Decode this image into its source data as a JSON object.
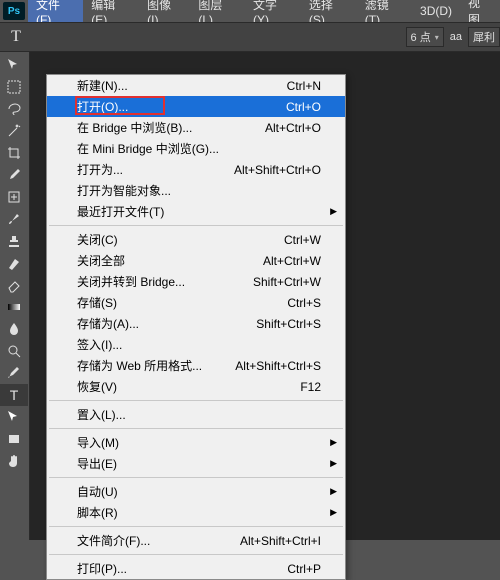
{
  "logo": "Ps",
  "menubar": [
    {
      "label": "文件(F)",
      "active": true
    },
    {
      "label": "编辑(E)"
    },
    {
      "label": "图像(I)"
    },
    {
      "label": "图层(L)"
    },
    {
      "label": "文字(Y)"
    },
    {
      "label": "选择(S)"
    },
    {
      "label": "滤镜(T)"
    },
    {
      "label": "3D(D)"
    },
    {
      "label": "视图"
    }
  ],
  "optbar": {
    "tool_glyph": "T",
    "size_value": "6 点",
    "aa_label": "aa",
    "mode_label": "犀利"
  },
  "dropdown": [
    {
      "type": "item",
      "label": "新建(N)...",
      "shortcut": "Ctrl+N"
    },
    {
      "type": "item",
      "label": "打开(O)...",
      "shortcut": "Ctrl+O",
      "highlight": true,
      "boxed": true
    },
    {
      "type": "item",
      "label": "在 Bridge 中浏览(B)...",
      "shortcut": "Alt+Ctrl+O"
    },
    {
      "type": "item",
      "label": "在 Mini Bridge 中浏览(G)..."
    },
    {
      "type": "item",
      "label": "打开为...",
      "shortcut": "Alt+Shift+Ctrl+O"
    },
    {
      "type": "item",
      "label": "打开为智能对象..."
    },
    {
      "type": "item",
      "label": "最近打开文件(T)",
      "submenu": true
    },
    {
      "type": "sep"
    },
    {
      "type": "item",
      "label": "关闭(C)",
      "shortcut": "Ctrl+W"
    },
    {
      "type": "item",
      "label": "关闭全部",
      "shortcut": "Alt+Ctrl+W"
    },
    {
      "type": "item",
      "label": "关闭并转到 Bridge...",
      "shortcut": "Shift+Ctrl+W"
    },
    {
      "type": "item",
      "label": "存储(S)",
      "shortcut": "Ctrl+S"
    },
    {
      "type": "item",
      "label": "存储为(A)...",
      "shortcut": "Shift+Ctrl+S"
    },
    {
      "type": "item",
      "label": "签入(I)..."
    },
    {
      "type": "item",
      "label": "存储为 Web 所用格式...",
      "shortcut": "Alt+Shift+Ctrl+S"
    },
    {
      "type": "item",
      "label": "恢复(V)",
      "shortcut": "F12"
    },
    {
      "type": "sep"
    },
    {
      "type": "item",
      "label": "置入(L)..."
    },
    {
      "type": "sep"
    },
    {
      "type": "item",
      "label": "导入(M)",
      "submenu": true
    },
    {
      "type": "item",
      "label": "导出(E)",
      "submenu": true
    },
    {
      "type": "sep"
    },
    {
      "type": "item",
      "label": "自动(U)",
      "submenu": true
    },
    {
      "type": "item",
      "label": "脚本(R)",
      "submenu": true
    },
    {
      "type": "sep"
    },
    {
      "type": "item",
      "label": "文件简介(F)...",
      "shortcut": "Alt+Shift+Ctrl+I"
    },
    {
      "type": "sep"
    },
    {
      "type": "item",
      "label": "打印(P)...",
      "shortcut": "Ctrl+P"
    }
  ],
  "tools": [
    "move",
    "marquee",
    "lasso",
    "wand",
    "crop",
    "eyedrop",
    "heal",
    "brush",
    "stamp",
    "history",
    "eraser",
    "gradient",
    "blur",
    "dodge",
    "pen",
    "type",
    "path",
    "rect",
    "hand"
  ]
}
